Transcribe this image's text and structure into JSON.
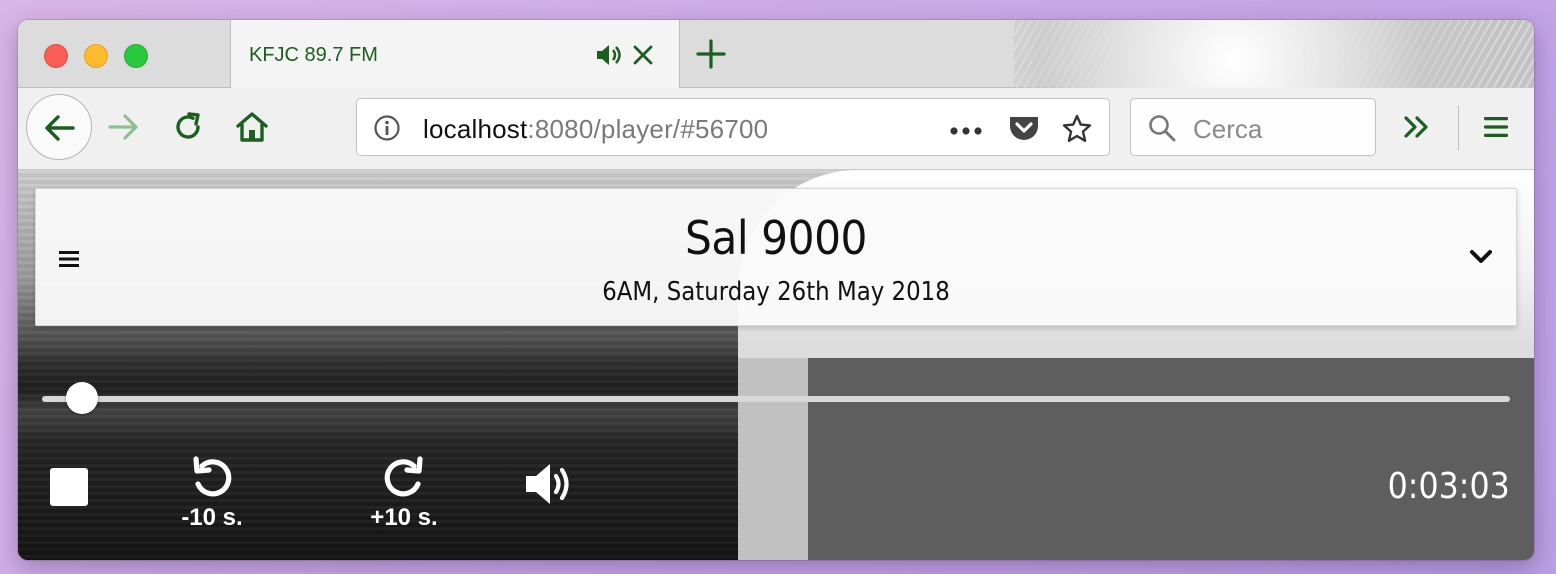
{
  "browser": {
    "tab": {
      "title": "KFJC 89.7 FM",
      "audio_icon": "speaker-icon",
      "close_icon": "close-icon"
    },
    "new_tab_icon": "plus-icon",
    "nav": {
      "back_icon": "arrow-left-icon",
      "forward_icon": "arrow-right-icon",
      "reload_icon": "reload-icon",
      "home_icon": "home-icon"
    },
    "url": {
      "host": "localhost",
      "rest": ":8080/player/#56700"
    },
    "search": {
      "placeholder": "Cerca"
    },
    "toolbar_icons": [
      "page-actions-icon",
      "pocket-icon",
      "bookmark-star-icon",
      "overflow-chevrons-icon",
      "menu-icon"
    ]
  },
  "player": {
    "show_title": "Sal 9000",
    "show_datetime": "6AM, Saturday 26th May 2018",
    "progress": 0.027,
    "rewind_label": "-10 s.",
    "forward_label": "+10 s.",
    "elapsed": "0:03:03"
  },
  "colors": {
    "accent": "#1b5e20",
    "traffic_red": "#fc5f57",
    "traffic_yellow": "#fdbc2e",
    "traffic_green": "#28c840"
  }
}
